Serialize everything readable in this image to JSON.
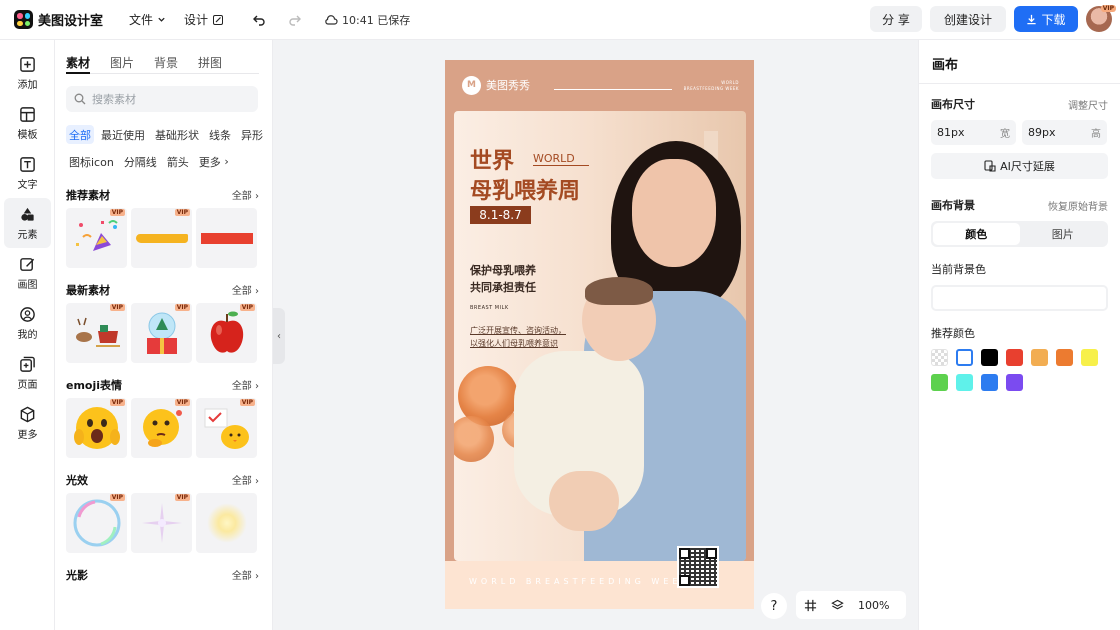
{
  "app": {
    "title": "美图设计室"
  },
  "menu": {
    "file": "文件",
    "design": "设计",
    "saved": "10:41 已保存"
  },
  "toolbar": {
    "share": "分 享",
    "create": "创建设计",
    "download": "下载",
    "avatar_badge": "VIP"
  },
  "rail": [
    {
      "label": "添加",
      "icon": "plus-square-icon"
    },
    {
      "label": "模板",
      "icon": "template-icon"
    },
    {
      "label": "文字",
      "icon": "text-icon"
    },
    {
      "label": "元素",
      "icon": "shapes-icon"
    },
    {
      "label": "画图",
      "icon": "pencil-icon"
    },
    {
      "label": "我的",
      "icon": "user-icon"
    },
    {
      "label": "页面",
      "icon": "page-add-icon"
    },
    {
      "label": "更多",
      "icon": "cube-icon"
    }
  ],
  "panel": {
    "tabs": [
      "素材",
      "图片",
      "背景",
      "拼图"
    ],
    "search_placeholder": "搜索素材",
    "chips": [
      "全部",
      "最近使用",
      "基础形状",
      "线条",
      "异形",
      "图标icon",
      "分隔线",
      "箭头",
      "更多"
    ],
    "vip": "VIP",
    "all_label": "全部",
    "sections": [
      "推荐素材",
      "最新素材",
      "emoji表情",
      "光效",
      "光影"
    ]
  },
  "poster": {
    "brand": "美图秀秀",
    "corner_text": "WORLD BREASTFEEDING WEEK",
    "title1": "世界",
    "world": "WORLD",
    "title2": "母乳喂养周",
    "date": "8.1-8.7",
    "slogan1": "保护母乳喂养",
    "slogan2": "共同承担责任",
    "small_en": "BREAST MILK",
    "desc1": "广泛开展宣传、咨询活动，",
    "desc2": "以强化人们母乳喂养意识",
    "bottom_text": "WORLD BREASTFEEDING WEEK"
  },
  "canvas": {
    "help": "?",
    "zoom": "100%"
  },
  "right": {
    "title": "画布",
    "size_label": "画布尺寸",
    "adjust_link": "调整尺寸",
    "width_value": "81px",
    "width_unit": "宽",
    "height_value": "89px",
    "height_unit": "高",
    "ai_button": "AI尺寸延展",
    "bg_label": "画布背景",
    "restore_link": "恢复原始背景",
    "seg_color": "颜色",
    "seg_image": "图片",
    "current_bg": "当前背景色",
    "recommended": "推荐颜色",
    "colors": [
      "transparent",
      "#ffffff",
      "#000000",
      "#e8402f",
      "#f2ad52",
      "#ec7b30",
      "#f7f04a",
      "#5dd14e",
      "#5ff1ea",
      "#2d7cf0",
      "#7b4bf0"
    ]
  }
}
